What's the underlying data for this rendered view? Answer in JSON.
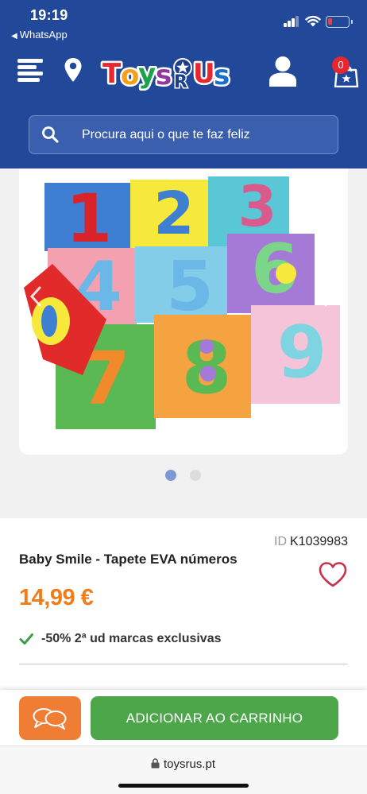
{
  "status_bar": {
    "time": "19:19",
    "back_app": "WhatsApp",
    "battery_color": "#ff3b30"
  },
  "header": {
    "background": "#22489a",
    "logo_text": "Toys\"R\"Us",
    "cart_count": "0",
    "search": {
      "placeholder": "Procura aqui o que te faz feliz"
    },
    "icons": [
      "menu-icon",
      "location-pin-icon",
      "user-icon",
      "cart-icon"
    ]
  },
  "gallery": {
    "image_alt": "Tapete EVA números 0-9",
    "pages": 2,
    "active_page": 1,
    "active_dot_color": "#7e98d6",
    "inactive_dot_color": "#dcdcdc"
  },
  "product": {
    "id_prefix": "ID",
    "id": "K1039983",
    "title": "Baby Smile - Tapete EVA números",
    "price": "14,99 €",
    "price_color": "#ef7d1a",
    "promo": "-50% 2ª ud marcas exclusivas",
    "promo_icon": "check-icon",
    "wishlist_icon": "heart-icon"
  },
  "actions": {
    "chat_icon": "chat-bubbles-icon",
    "add_to_cart": "ADICIONAR AO CARRINHO",
    "add_to_cart_color": "#4ca74b",
    "chat_color": "#ef7d33"
  },
  "browser": {
    "url": "toysrus.pt"
  }
}
